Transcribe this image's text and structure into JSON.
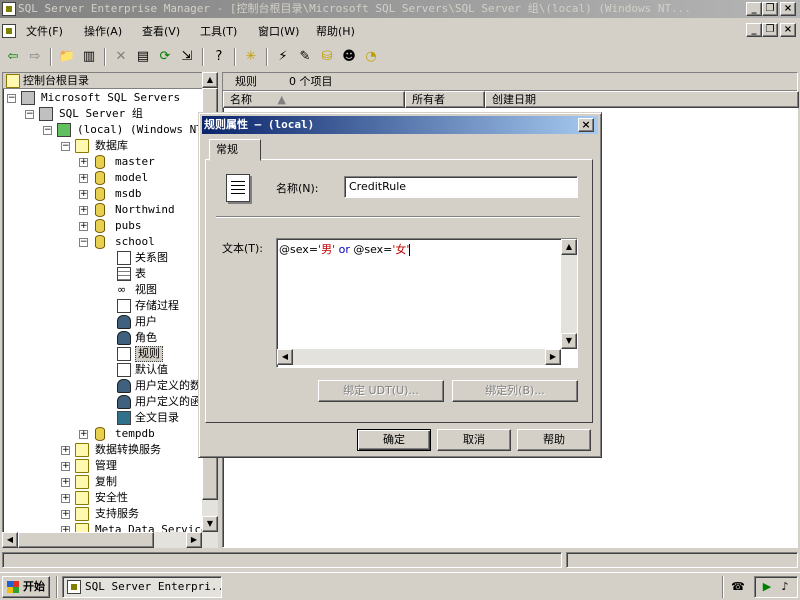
{
  "window": {
    "title": "SQL Server Enterprise Manager - [控制台根目录\\Microsoft SQL Servers\\SQL Server 组\\(local) (Windows NT..."
  },
  "menu": [
    "文件(F)",
    "操作(A)",
    "查看(V)",
    "工具(T)",
    "窗口(W)",
    "帮助(H)"
  ],
  "tree": {
    "header": "控制台根目录",
    "items": [
      "Microsoft SQL Servers",
      "SQL Server 组",
      "(local) (Windows NT)",
      "数据库",
      "master",
      "model",
      "msdb",
      "Northwind",
      "pubs",
      "school",
      "关系图",
      "表",
      "视图",
      "存储过程",
      "用户",
      "角色",
      "规则",
      "默认值",
      "用户定义的数",
      "用户定义的函",
      "全文目录",
      "tempdb",
      "数据转换服务",
      "管理",
      "复制",
      "安全性",
      "支持服务",
      "Meta Data Service"
    ]
  },
  "list": {
    "title": "规则",
    "count": "0 个项目",
    "columns": [
      "名称",
      "所有者",
      "创建日期"
    ]
  },
  "dialog": {
    "title": "规则属性 — (local)",
    "tab": "常规",
    "name_label": "名称(N):",
    "name_value": "CreditRule",
    "text_label": "文本(T):",
    "text_parts": [
      "@sex=",
      "'男'",
      " or ",
      "@sex=",
      "'女'"
    ],
    "bind_udt": "绑定 UDT(U)...",
    "bind_col": "绑定列(B)...",
    "ok": "确定",
    "cancel": "取消",
    "help": "帮助"
  },
  "taskbar": {
    "start": "开始",
    "task": "SQL Server Enterpri..."
  },
  "colors": {
    "dialog_title_start": "#0a246a",
    "dialog_title_end": "#a6caf0",
    "string_literal": "#c00000",
    "keyword": "#0000c0"
  }
}
